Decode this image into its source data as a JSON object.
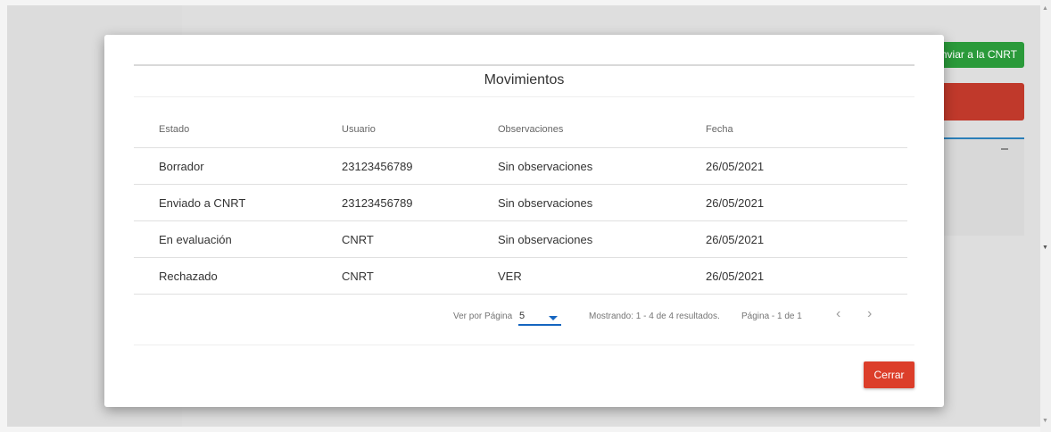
{
  "background": {
    "send_button_label": "nviar a la CNRT"
  },
  "modal": {
    "title": "Movimientos",
    "columns": [
      "Estado",
      "Usuario",
      "Observaciones",
      "Fecha"
    ],
    "rows": [
      [
        "Borrador",
        "23123456789",
        "Sin observaciones",
        "26/05/2021"
      ],
      [
        "Enviado a CNRT",
        "23123456789",
        "Sin observaciones",
        "26/05/2021"
      ],
      [
        "En evaluación",
        "CNRT",
        "Sin observaciones",
        "26/05/2021"
      ],
      [
        "Rechazado",
        "CNRT",
        "VER",
        "26/05/2021"
      ]
    ],
    "pagination": {
      "per_page_label": "Ver por Página",
      "per_page_value": "5",
      "showing": "Mostrando: 1 - 4 de 4 resultados.",
      "page": "Página - 1 de 1",
      "prev_icon": "chevron-left-icon",
      "next_icon": "chevron-right-icon"
    },
    "close_label": "Cerrar"
  },
  "colors": {
    "accent_blue": "#1565c0",
    "close_red": "#dc3e2a",
    "send_green": "#2a9a3a"
  }
}
